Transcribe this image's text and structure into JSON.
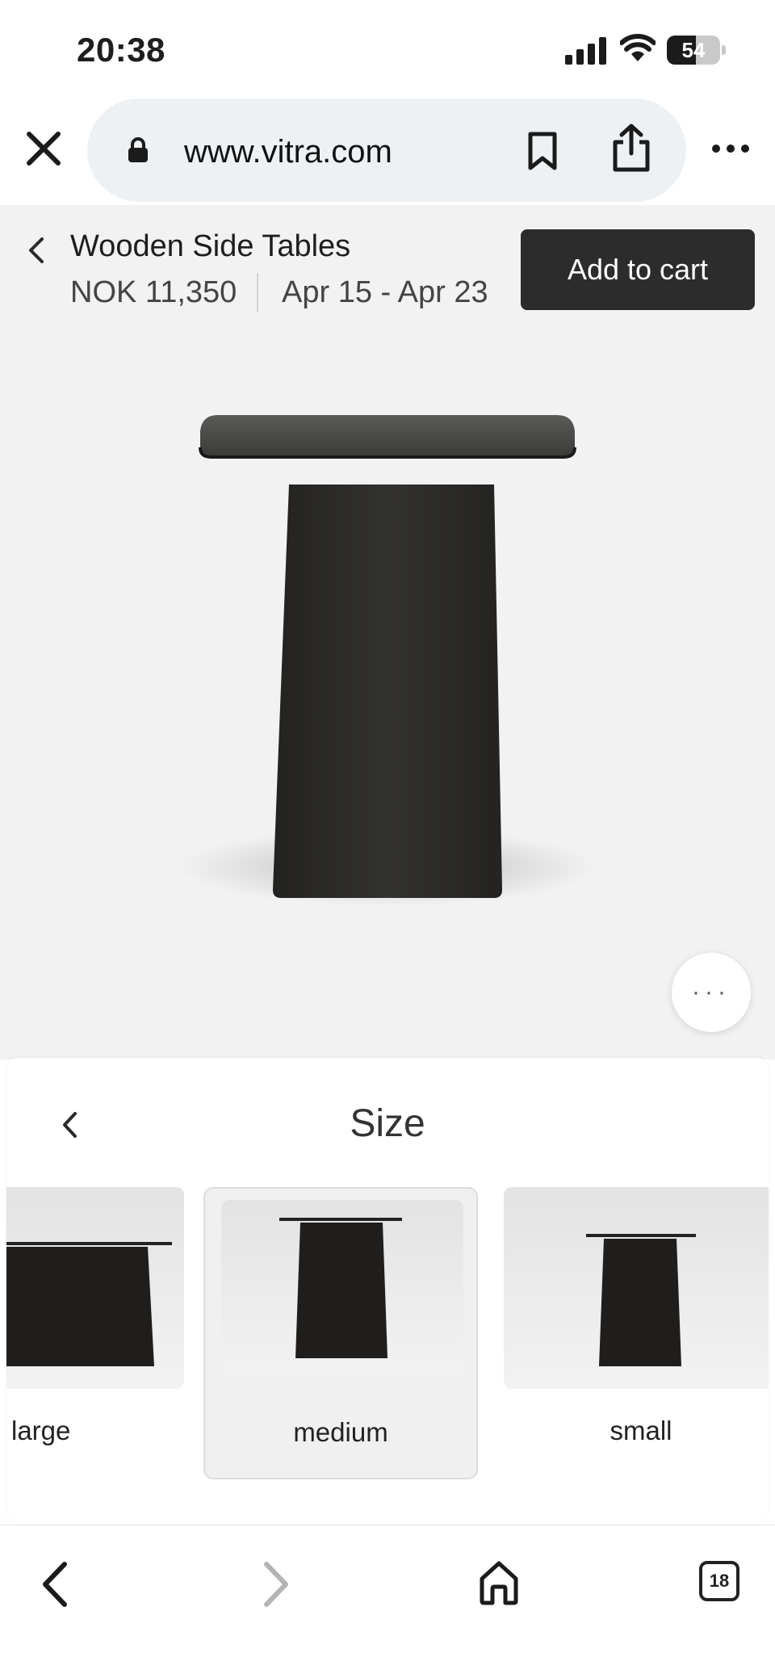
{
  "status_bar": {
    "time": "20:38",
    "battery_level": "54",
    "battery_percent": 54,
    "icons": [
      "signal-icon",
      "wifi-icon",
      "battery-icon"
    ]
  },
  "browser": {
    "url": "www.vitra.com",
    "icons": [
      "close-icon",
      "lock-icon",
      "bookmark-icon",
      "share-icon",
      "more-icon"
    ]
  },
  "product": {
    "title": "Wooden Side Tables",
    "price": "NOK 11,350",
    "delivery": "Apr 15 - Apr 23",
    "add_to_cart_label": "Add to cart",
    "more_options_label": "···"
  },
  "size_panel": {
    "title": "Size",
    "options": [
      {
        "label": "large",
        "selected": false
      },
      {
        "label": "medium",
        "selected": true
      },
      {
        "label": "small",
        "selected": false
      }
    ]
  },
  "toolbar": {
    "tab_count": "18",
    "icons": [
      "back-arrow-icon",
      "forward-arrow-icon",
      "home-icon",
      "tabs-icon"
    ]
  },
  "colors": {
    "accent_dark": "#2c2c2c",
    "page_bg": "#f2f2f2",
    "product_wood": "#2b2a28"
  }
}
